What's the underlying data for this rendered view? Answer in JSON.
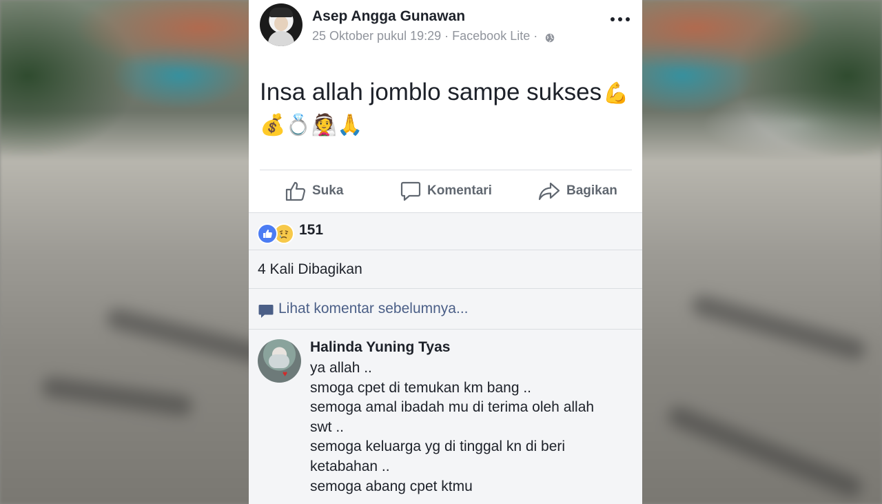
{
  "post": {
    "author": "Asep Angga Gunawan",
    "date": "25 Oktober pukul 19:29",
    "separator": "·",
    "source": "Facebook Lite",
    "text": "Insa allah jomblo sampe sukses",
    "emojis": "💪💰💍👰🙏"
  },
  "actions": {
    "like": "Suka",
    "comment": "Komentari",
    "share": "Bagikan"
  },
  "reactions": {
    "count": "151",
    "types": [
      "like-icon",
      "sad-icon"
    ]
  },
  "shares": {
    "text": "4 Kali Dibagikan"
  },
  "comments": {
    "view_previous": "Lihat komentar sebelumnya...",
    "items": [
      {
        "name": "Halinda Yuning Tyas",
        "lines": [
          "ya allah ..",
          "smoga cpet di temukan km bang ..",
          "semoga amal ibadah mu di terima oleh allah",
          "swt ..",
          "semoga keluarga yg di tinggal kn di beri",
          "ketabahan ..",
          "semoga abang cpet ktmu"
        ]
      }
    ]
  },
  "colors": {
    "like_blue": "#4b7cf3",
    "link_blue": "#4b5f87",
    "meta_gray": "#90949c",
    "section_bg": "#f4f5f7"
  }
}
